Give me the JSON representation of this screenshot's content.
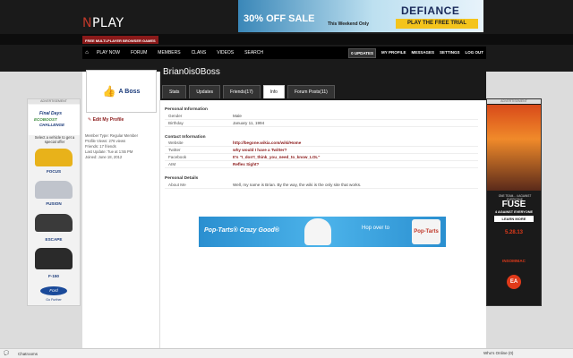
{
  "site": {
    "logo_n": "N",
    "logo_rest": "PLAY",
    "tagline": "FREE MULTI-PLAYER BROWSER GAMES"
  },
  "banner_top": {
    "sale_pct": "30% OFF SALE",
    "sale_text": "This Weekend Only",
    "title": "DEFIANCE",
    "cta": "PLAY THE FREE TRIAL"
  },
  "nav": {
    "home_icon": "home-icon",
    "main": [
      "PLAY NOW",
      "FORUM",
      "MEMBERS",
      "CLANS",
      "VIDEOS",
      "SEARCH"
    ],
    "updates": "0 UPDATES",
    "right": [
      "MY PROFILE",
      "MESSAGES",
      "SETTINGS",
      "LOG OUT"
    ]
  },
  "profile": {
    "username": "Brian0is0Boss",
    "avatar_text": "A Boss",
    "edit_label": "Edit My Profile",
    "meta": [
      "Member Type: Regular Member",
      "Profile Views: 276 views",
      "Friends: 17 friends",
      "Last Update: Tue at 1:55 PM",
      "Joined: June 18, 2012"
    ],
    "tabs": [
      "Stats",
      "Updates",
      "Friends(17)",
      "Info",
      "Forum Posts(11)"
    ],
    "active_tab": "Info",
    "personal_title": "Personal Information",
    "personal": [
      {
        "k": "Gender",
        "v": "Male"
      },
      {
        "k": "Birthday",
        "v": "January 11, 1994"
      }
    ],
    "contact_title": "Contact Information",
    "contact": [
      {
        "k": "Website",
        "v": "http://begone.wikia.com/wiki/Home"
      },
      {
        "k": "Twitter",
        "v": "why would I have a Twitter?"
      },
      {
        "k": "Facebook",
        "v": "It's \"I_don't_think_you_need_to_know_LOL\""
      },
      {
        "k": "AIM",
        "v": "Reflex Sight?"
      }
    ],
    "details_title": "Personal Details",
    "details": [
      {
        "k": "About Me",
        "v": "Well, my name is Brian. By the way, the wiki is the only site that works."
      }
    ]
  },
  "poptarts_ad": {
    "left": "Pop-Tarts® Crazy Good®",
    "right": "Hop over to",
    "box": "Pop-Tarts"
  },
  "left_ad": {
    "label": "ADVERTISEMENT",
    "l1": "Final Days",
    "l2": "ECOBOOST",
    "l3": "CHALLENGE",
    "select": "Select a vehicle to get a special offer",
    "cars": [
      {
        "name": "FOCUS",
        "color": "#e8b21a"
      },
      {
        "name": "FUSION",
        "color": "#c0c4cc"
      },
      {
        "name": "ESCAPE",
        "color": "#3a3a3a"
      },
      {
        "name": "F-150",
        "color": "#2a2a2a"
      }
    ],
    "brand": "Ford",
    "tag": "Go Further"
  },
  "right_ad": {
    "label": "ADVERTISEMENT",
    "tag": "ONE TEAM... 4 AGAINST EVERYONE",
    "title": "FUSE",
    "sub": "4 AGAINST EVERYONE",
    "cta": "LEARN MORE",
    "date": "5.28.13",
    "studio": "INSOMNIAC",
    "publisher": "EA"
  },
  "bottom_bar": {
    "chat": "Chatrooms",
    "who": "Who's Online (0)"
  }
}
